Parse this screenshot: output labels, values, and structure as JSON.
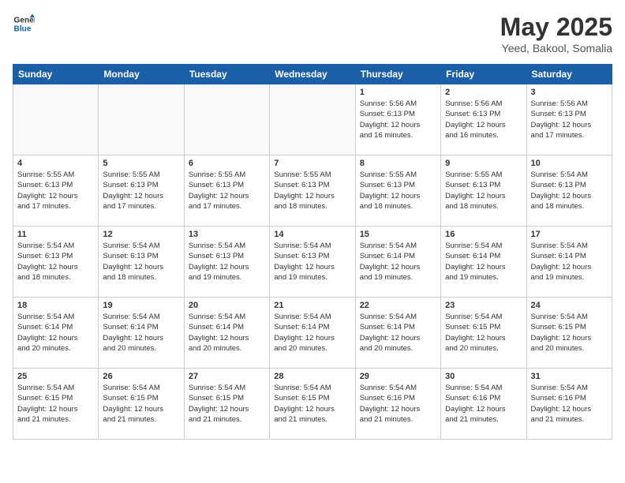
{
  "header": {
    "logo": {
      "general": "General",
      "blue": "Blue"
    },
    "title": "May 2025",
    "subtitle": "Yeed, Bakool, Somalia"
  },
  "calendar": {
    "headers": [
      "Sunday",
      "Monday",
      "Tuesday",
      "Wednesday",
      "Thursday",
      "Friday",
      "Saturday"
    ],
    "weeks": [
      [
        {
          "day": "",
          "info": ""
        },
        {
          "day": "",
          "info": ""
        },
        {
          "day": "",
          "info": ""
        },
        {
          "day": "",
          "info": ""
        },
        {
          "day": "1",
          "info": "Sunrise: 5:56 AM\nSunset: 6:13 PM\nDaylight: 12 hours\nand 16 minutes."
        },
        {
          "day": "2",
          "info": "Sunrise: 5:56 AM\nSunset: 6:13 PM\nDaylight: 12 hours\nand 16 minutes."
        },
        {
          "day": "3",
          "info": "Sunrise: 5:56 AM\nSunset: 6:13 PM\nDaylight: 12 hours\nand 17 minutes."
        }
      ],
      [
        {
          "day": "4",
          "info": "Sunrise: 5:55 AM\nSunset: 6:13 PM\nDaylight: 12 hours\nand 17 minutes."
        },
        {
          "day": "5",
          "info": "Sunrise: 5:55 AM\nSunset: 6:13 PM\nDaylight: 12 hours\nand 17 minutes."
        },
        {
          "day": "6",
          "info": "Sunrise: 5:55 AM\nSunset: 6:13 PM\nDaylight: 12 hours\nand 17 minutes."
        },
        {
          "day": "7",
          "info": "Sunrise: 5:55 AM\nSunset: 6:13 PM\nDaylight: 12 hours\nand 18 minutes."
        },
        {
          "day": "8",
          "info": "Sunrise: 5:55 AM\nSunset: 6:13 PM\nDaylight: 12 hours\nand 18 minutes."
        },
        {
          "day": "9",
          "info": "Sunrise: 5:55 AM\nSunset: 6:13 PM\nDaylight: 12 hours\nand 18 minutes."
        },
        {
          "day": "10",
          "info": "Sunrise: 5:54 AM\nSunset: 6:13 PM\nDaylight: 12 hours\nand 18 minutes."
        }
      ],
      [
        {
          "day": "11",
          "info": "Sunrise: 5:54 AM\nSunset: 6:13 PM\nDaylight: 12 hours\nand 18 minutes."
        },
        {
          "day": "12",
          "info": "Sunrise: 5:54 AM\nSunset: 6:13 PM\nDaylight: 12 hours\nand 18 minutes."
        },
        {
          "day": "13",
          "info": "Sunrise: 5:54 AM\nSunset: 6:13 PM\nDaylight: 12 hours\nand 19 minutes."
        },
        {
          "day": "14",
          "info": "Sunrise: 5:54 AM\nSunset: 6:13 PM\nDaylight: 12 hours\nand 19 minutes."
        },
        {
          "day": "15",
          "info": "Sunrise: 5:54 AM\nSunset: 6:14 PM\nDaylight: 12 hours\nand 19 minutes."
        },
        {
          "day": "16",
          "info": "Sunrise: 5:54 AM\nSunset: 6:14 PM\nDaylight: 12 hours\nand 19 minutes."
        },
        {
          "day": "17",
          "info": "Sunrise: 5:54 AM\nSunset: 6:14 PM\nDaylight: 12 hours\nand 19 minutes."
        }
      ],
      [
        {
          "day": "18",
          "info": "Sunrise: 5:54 AM\nSunset: 6:14 PM\nDaylight: 12 hours\nand 20 minutes."
        },
        {
          "day": "19",
          "info": "Sunrise: 5:54 AM\nSunset: 6:14 PM\nDaylight: 12 hours\nand 20 minutes."
        },
        {
          "day": "20",
          "info": "Sunrise: 5:54 AM\nSunset: 6:14 PM\nDaylight: 12 hours\nand 20 minutes."
        },
        {
          "day": "21",
          "info": "Sunrise: 5:54 AM\nSunset: 6:14 PM\nDaylight: 12 hours\nand 20 minutes."
        },
        {
          "day": "22",
          "info": "Sunrise: 5:54 AM\nSunset: 6:14 PM\nDaylight: 12 hours\nand 20 minutes."
        },
        {
          "day": "23",
          "info": "Sunrise: 5:54 AM\nSunset: 6:15 PM\nDaylight: 12 hours\nand 20 minutes."
        },
        {
          "day": "24",
          "info": "Sunrise: 5:54 AM\nSunset: 6:15 PM\nDaylight: 12 hours\nand 20 minutes."
        }
      ],
      [
        {
          "day": "25",
          "info": "Sunrise: 5:54 AM\nSunset: 6:15 PM\nDaylight: 12 hours\nand 21 minutes."
        },
        {
          "day": "26",
          "info": "Sunrise: 5:54 AM\nSunset: 6:15 PM\nDaylight: 12 hours\nand 21 minutes."
        },
        {
          "day": "27",
          "info": "Sunrise: 5:54 AM\nSunset: 6:15 PM\nDaylight: 12 hours\nand 21 minutes."
        },
        {
          "day": "28",
          "info": "Sunrise: 5:54 AM\nSunset: 6:15 PM\nDaylight: 12 hours\nand 21 minutes."
        },
        {
          "day": "29",
          "info": "Sunrise: 5:54 AM\nSunset: 6:16 PM\nDaylight: 12 hours\nand 21 minutes."
        },
        {
          "day": "30",
          "info": "Sunrise: 5:54 AM\nSunset: 6:16 PM\nDaylight: 12 hours\nand 21 minutes."
        },
        {
          "day": "31",
          "info": "Sunrise: 5:54 AM\nSunset: 6:16 PM\nDaylight: 12 hours\nand 21 minutes."
        }
      ]
    ]
  }
}
